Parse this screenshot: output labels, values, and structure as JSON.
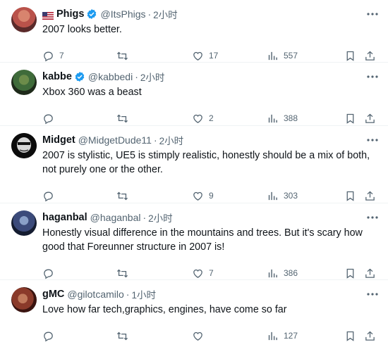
{
  "tweets": [
    {
      "name": "Phigs",
      "flag": true,
      "verified": true,
      "handle": "@ItsPhigs",
      "separator": "·",
      "time": "2小时",
      "text": "2007 looks better.",
      "replies": "7",
      "likes": "17",
      "views": "557",
      "avatar_colors": [
        "#b9524a",
        "#5a2a2a"
      ]
    },
    {
      "name": "kabbe",
      "flag": false,
      "verified": true,
      "handle": "@kabbedi",
      "separator": "·",
      "time": "2小时",
      "text": "Xbox 360 was a beast",
      "replies": "",
      "likes": "2",
      "views": "388",
      "avatar_colors": [
        "#3f6b3a",
        "#1e2a1a"
      ]
    },
    {
      "name": "Midget",
      "flag": false,
      "verified": false,
      "handle": "@MidgetDude11",
      "separator": "·",
      "time": "2小时",
      "text": "2007 is stylistic, UE5 is stimply realistic, honestly should be a mix of both, not purely one or the other.",
      "replies": "",
      "likes": "9",
      "views": "303",
      "avatar_colors": [
        "#1a1a1a",
        "#000000"
      ]
    },
    {
      "name": "haganbal",
      "flag": false,
      "verified": false,
      "handle": "@haganbal",
      "separator": "·",
      "time": "2小时",
      "text": "Honestly visual difference in the mountains and trees. But it's scary how good that Foreunner structure in 2007 is!",
      "replies": "",
      "likes": "7",
      "views": "386",
      "avatar_colors": [
        "#3b4a7a",
        "#141c30"
      ]
    },
    {
      "name": "gMC",
      "flag": false,
      "verified": false,
      "handle": "@gilotcamilo",
      "separator": "·",
      "time": "1小时",
      "text": "Love how far tech,graphics, engines, have come so far",
      "replies": "",
      "likes": "",
      "views": "127",
      "avatar_colors": [
        "#8a3a2a",
        "#3a1410"
      ]
    }
  ],
  "colors": {
    "text": "#0f1419",
    "secondary": "#536471",
    "verified": "#1d9bf0",
    "border": "#eff3f4"
  }
}
